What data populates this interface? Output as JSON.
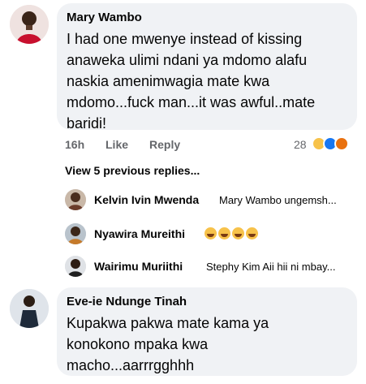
{
  "comments": [
    {
      "author": "Mary Wambo",
      "text": "I had one mwenye instead of kissing\nanaweka ulimi ndani ya mdomo alafu\nnaskia amenimwagia mate kwa\nmdomo...fuck man...it was awful..mate\nbaridi!",
      "time": "16h",
      "like_label": "Like",
      "reply_label": "Reply",
      "reaction_count": "28"
    },
    {
      "author": "Eve-ie Ndunge Tinah",
      "text": "Kupakwa pakwa mate kama ya\nkonokono mpaka kwa\nmacho...aarrrgghhh"
    }
  ],
  "view_previous": "View 5 previous replies...",
  "replies": [
    {
      "author": "Kelvin Ivin Mwenda",
      "text": "Mary Wambo ungemsh..."
    },
    {
      "author": "Nyawira Mureithi",
      "text": ""
    },
    {
      "author": "Wairimu Muriithi",
      "text": "Stephy Kim Aii hii ni mbay..."
    }
  ],
  "colors": {
    "bubble": "#f0f2f5",
    "haha": "#f7c24a",
    "like": "#1877f2",
    "angry": "#e9710f"
  }
}
